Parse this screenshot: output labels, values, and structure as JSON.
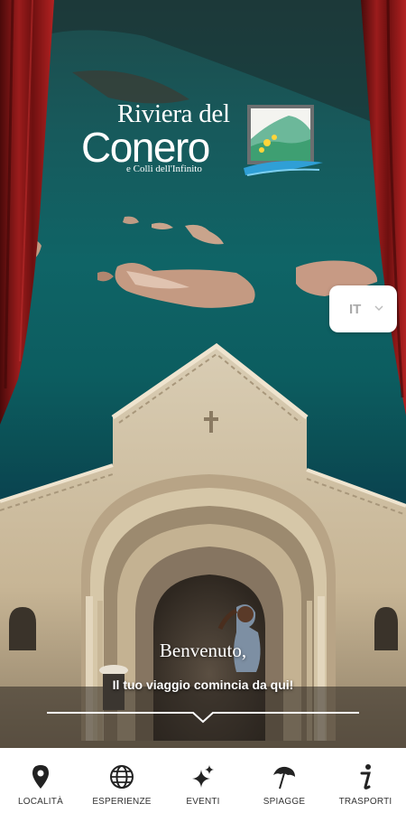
{
  "brand": {
    "line1": "Riviera del",
    "line2": "Conero",
    "line3": "e Colli dell'Infinito",
    "logo_icon": "conero-promontory-logo",
    "colors": {
      "sea": "#0f6466",
      "curtain": "#8a1a1a",
      "logo_green": "#6cc24a",
      "logo_blue": "#2f9fd6"
    }
  },
  "language": {
    "code": "IT",
    "icon": "chevron-down-icon"
  },
  "welcome": {
    "title": "Benvenuto,",
    "subtitle": "Il tuo viaggio comincia da qui!"
  },
  "tabs": [
    {
      "label": "LOCALITÀ",
      "icon": "map-pin-icon"
    },
    {
      "label": "ESPERIENZE",
      "icon": "globe-icon"
    },
    {
      "label": "EVENTI",
      "icon": "sparkle-icon"
    },
    {
      "label": "SPIAGGE",
      "icon": "umbrella-icon"
    },
    {
      "label": "TRASPORTI",
      "icon": "info-icon"
    }
  ]
}
